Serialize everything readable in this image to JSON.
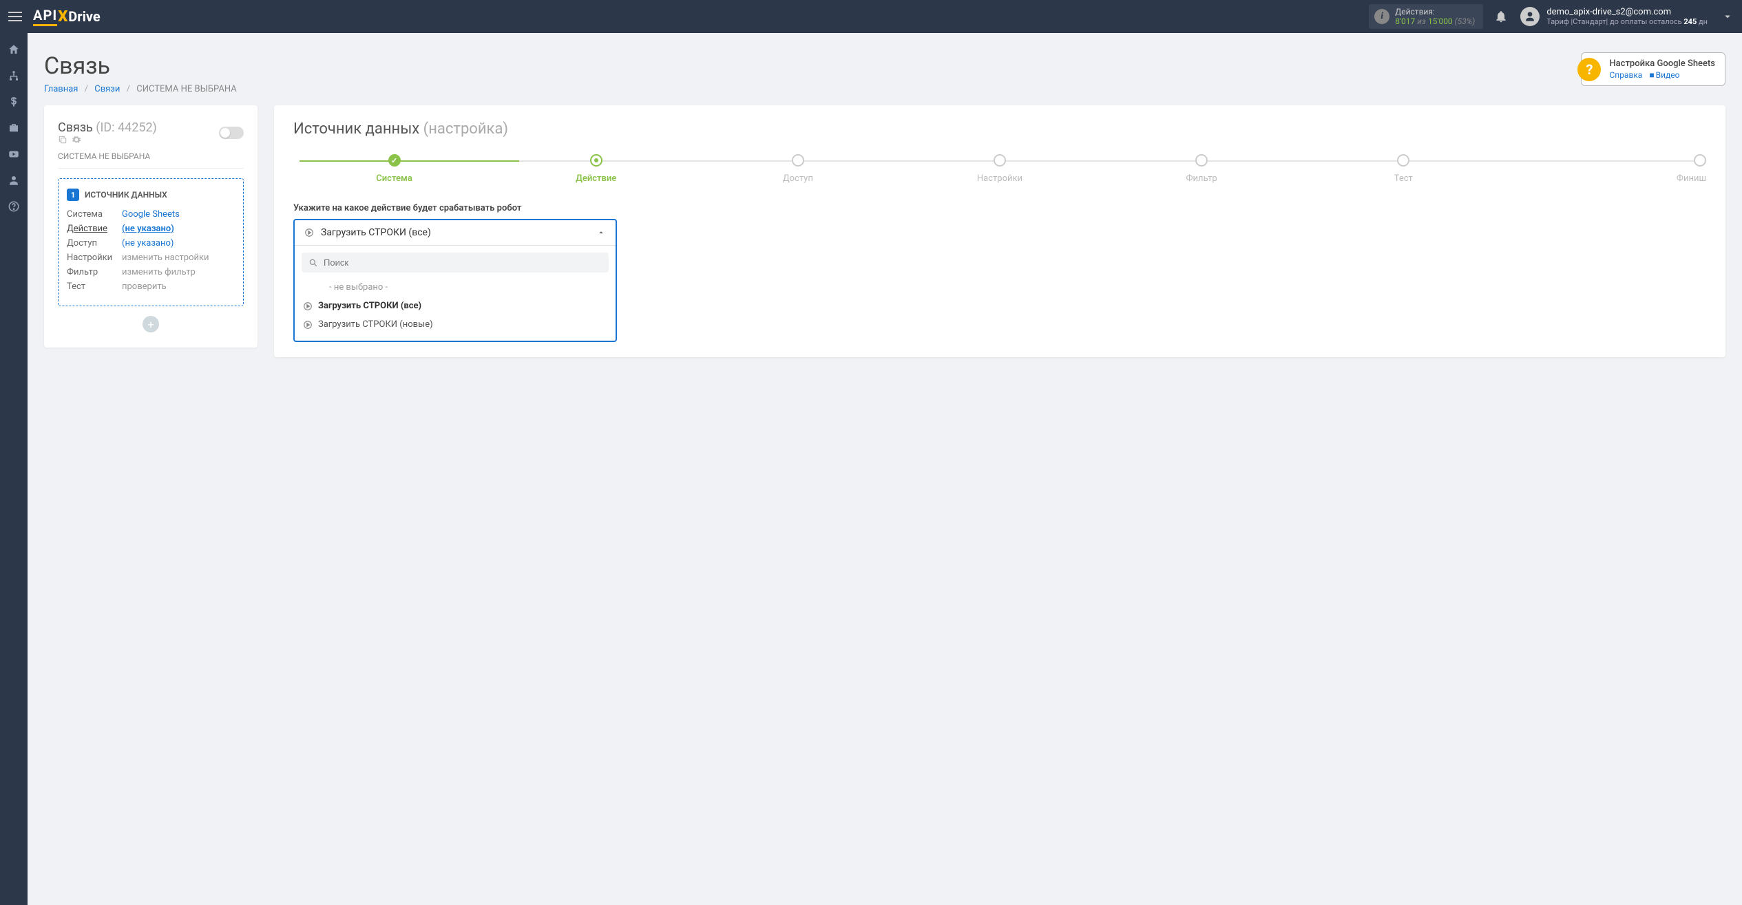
{
  "brand": {
    "part1": "API",
    "x": "X",
    "part2": "Drive"
  },
  "topbar": {
    "actions_label": "Действия:",
    "actions_used": "8'017",
    "actions_sep": "из",
    "actions_total": "15'000",
    "actions_pct": "(53%)",
    "user_email": "demo_apix-drive_s2@com.com",
    "tariff_prefix": "Тариф |Стандарт| до оплаты осталось ",
    "tariff_days": "245",
    "tariff_suffix": " дн"
  },
  "page": {
    "title": "Связь",
    "breadcrumb_home": "Главная",
    "breadcrumb_links": "Связи",
    "breadcrumb_current": "СИСТЕМА НЕ ВЫБРАНА"
  },
  "help": {
    "title": "Настройка Google Sheets",
    "link1": "Справка",
    "link2": "Видео"
  },
  "left": {
    "title": "Связь",
    "id_label": "(ID: 44252)",
    "sub": "СИСТЕМА НЕ ВЫБРАНА",
    "block_num": "1",
    "block_title": "ИСТОЧНИК ДАННЫХ",
    "rows": {
      "system_k": "Система",
      "system_v": "Google Sheets",
      "action_k": "Действие",
      "action_v": "(не указано)",
      "access_k": "Доступ",
      "access_v": "(не указано)",
      "settings_k": "Настройки",
      "settings_v": "изменить настройки",
      "filter_k": "Фильтр",
      "filter_v": "изменить фильтр",
      "test_k": "Тест",
      "test_v": "проверить"
    }
  },
  "right": {
    "title": "Источник данных",
    "title_sub": "(настройка)",
    "steps": [
      "Система",
      "Действие",
      "Доступ",
      "Настройки",
      "Фильтр",
      "Тест",
      "Финиш"
    ],
    "form_label": "Укажите на какое действие будет срабатывать робот",
    "selected": "Загрузить СТРОКИ (все)",
    "search_placeholder": "Поиск",
    "option_empty": "- не выбрано -",
    "option_1": "Загрузить СТРОКИ (все)",
    "option_2": "Загрузить СТРОКИ (новые)"
  }
}
